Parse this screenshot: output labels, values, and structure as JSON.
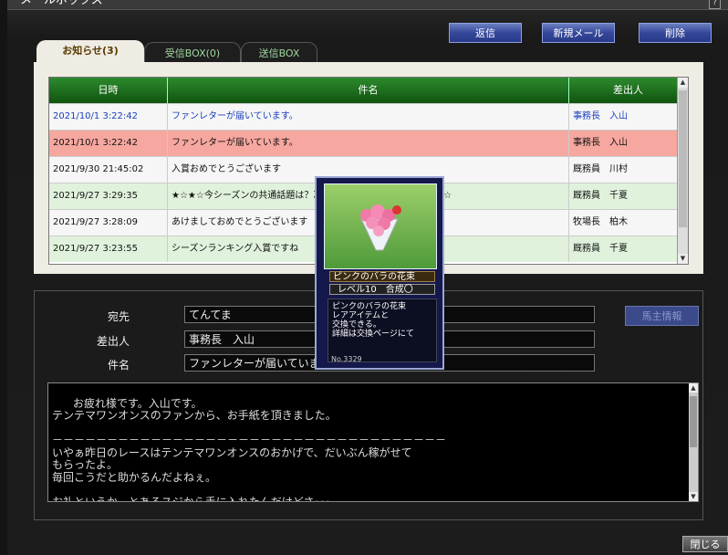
{
  "window": {
    "title": "メールボックス",
    "help_label": "?"
  },
  "toolbar": {
    "reply": "返信",
    "new_mail": "新規メール",
    "delete": "削除"
  },
  "tabs": [
    {
      "label": "お知らせ(3)",
      "active": true
    },
    {
      "label": "受信BOX(0)",
      "active": false
    },
    {
      "label": "送信BOX",
      "active": false
    }
  ],
  "table": {
    "columns": [
      "日時",
      "件名",
      "差出人"
    ],
    "rows": [
      {
        "date": "2021/10/1 3:22:42",
        "subject": "ファンレターが届いています。",
        "sender": "事務長　入山",
        "style": "unread"
      },
      {
        "date": "2021/10/1 3:22:42",
        "subject": "ファンレターが届いています。",
        "sender": "事務長　入山",
        "style": "selected"
      },
      {
        "date": "2021/9/30 21:45:02",
        "subject": "入賞おめでとうございます",
        "sender": "厩務員　川村",
        "style": "read"
      },
      {
        "date": "2021/9/27 3:29:35",
        "subject": "★☆★☆今シーズンの共通話題は？次のシーズンも楽しみと♪★☆★☆",
        "sender": "厩務員　千夏",
        "style": "green"
      },
      {
        "date": "2021/9/27 3:28:09",
        "subject": "あけましておめでとうございます",
        "sender": "牧場長　柏木",
        "style": "read"
      },
      {
        "date": "2021/9/27 3:23:55",
        "subject": "シーズンランキング入賞ですね",
        "sender": "厩務員　千夏",
        "style": "green"
      }
    ]
  },
  "detail": {
    "to_label": "宛先",
    "to_value": "てんてま",
    "from_label": "差出人",
    "from_value": "事務長　入山",
    "subject_label": "件名",
    "subject_value": "ファンレターが届いています。",
    "horse_info": "馬主情報",
    "body": "お疲れ様です。入山です。\nテンテマワンオンスのファンから、お手紙を頂きました。\n\n－－－－－－－－－－－－－－－－－－－－－－－－－－－－－－－－－－－－\nいやぁ昨日のレースはテンテマワンオンスのおかげで、だいぶん稼がせて\nもらったよ。\n毎回こうだと助かるんだよねぇ。\n\nお礼というか、とあるスジから手に入れたんだけどさ･･･"
  },
  "item_card": {
    "name": "ピンクのバラの花束",
    "level": "レベル10　合成〇",
    "description": "ピンクのバラの花束\nレアアイテムと\n交換できる。\n詳細は交換ページにて",
    "number": "No.3329"
  },
  "footer": {
    "close": "閉じる"
  },
  "colors": {
    "header_green": "#1a6e1a",
    "unread_text": "#1a3fbf",
    "selected_row": "#f6a79f",
    "green_row": "#e0f2dc",
    "button_blue": "#35479a"
  }
}
